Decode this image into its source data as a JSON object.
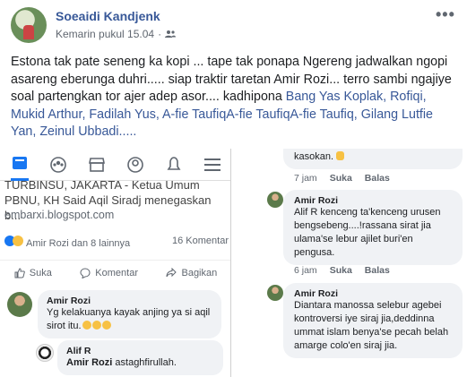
{
  "post": {
    "author": "Soeaidi Kandjenk",
    "time": "Kemarin pukul 15.04",
    "more": "•••",
    "caption_text": "Estona tak pate seneng ka kopi ... tape tak ponapa Ngereng jadwalkan ngopi asareng eberunga duhri..... siap traktir taretan Amir Rozi... terro sambi ngajiye soal partengkan tor ajer adep asor.... kadhipona ",
    "mentions": "Bang Yas Koplak, Rofiqi, Mukid Arthur, Fadilah Yus, A-fie TaufiqA-fie TaufiqA-fie Taufiq, Gilang Lutfie Yan, Zeinul Ubbadi....."
  },
  "left_shot": {
    "article_line1": "TURBINSU, JAKARTA - Ketua Umum",
    "article_line2": "PBNU, KH Said Aqil Siradj menegaskan b...",
    "source": "embarxi.blogspot.com",
    "reactors": "Amir Rozi dan 8 lainnya",
    "comment_count": "16 Komentar",
    "actions": {
      "like": "Suka",
      "comment": "Komentar",
      "share": "Bagikan"
    },
    "comment1": {
      "name": "Amir Rozi",
      "text": "Yg kelakuanya kayak anjing ya si aqil sirot itu."
    },
    "reply1": {
      "name": "Alif R",
      "mention": "Amir Rozi",
      "text": " astaghfirullah."
    }
  },
  "right_shot": {
    "top_text": "kasokan.",
    "top_meta": {
      "time": "7 jam",
      "like": "Suka",
      "reply": "Balas"
    },
    "comment2": {
      "name": "Amir Rozi",
      "text": "Alif R kenceng ta'kenceng urusen bengsebeng....!rassana sirat jia ulama'se lebur ajilet buri'en pengusa."
    },
    "meta2": {
      "time": "6 jam",
      "like": "Suka",
      "reply": "Balas"
    },
    "comment3": {
      "name": "Amir Rozi",
      "text": "Diantara manossa selebur agebei kontroversi iye siraj jia,deddinna ummat islam benya'se pecah belah amarge colo'en siraj jia."
    }
  },
  "colors": {
    "link": "#385898",
    "accent": "#1877f2",
    "bubble": "#f0f2f5"
  }
}
